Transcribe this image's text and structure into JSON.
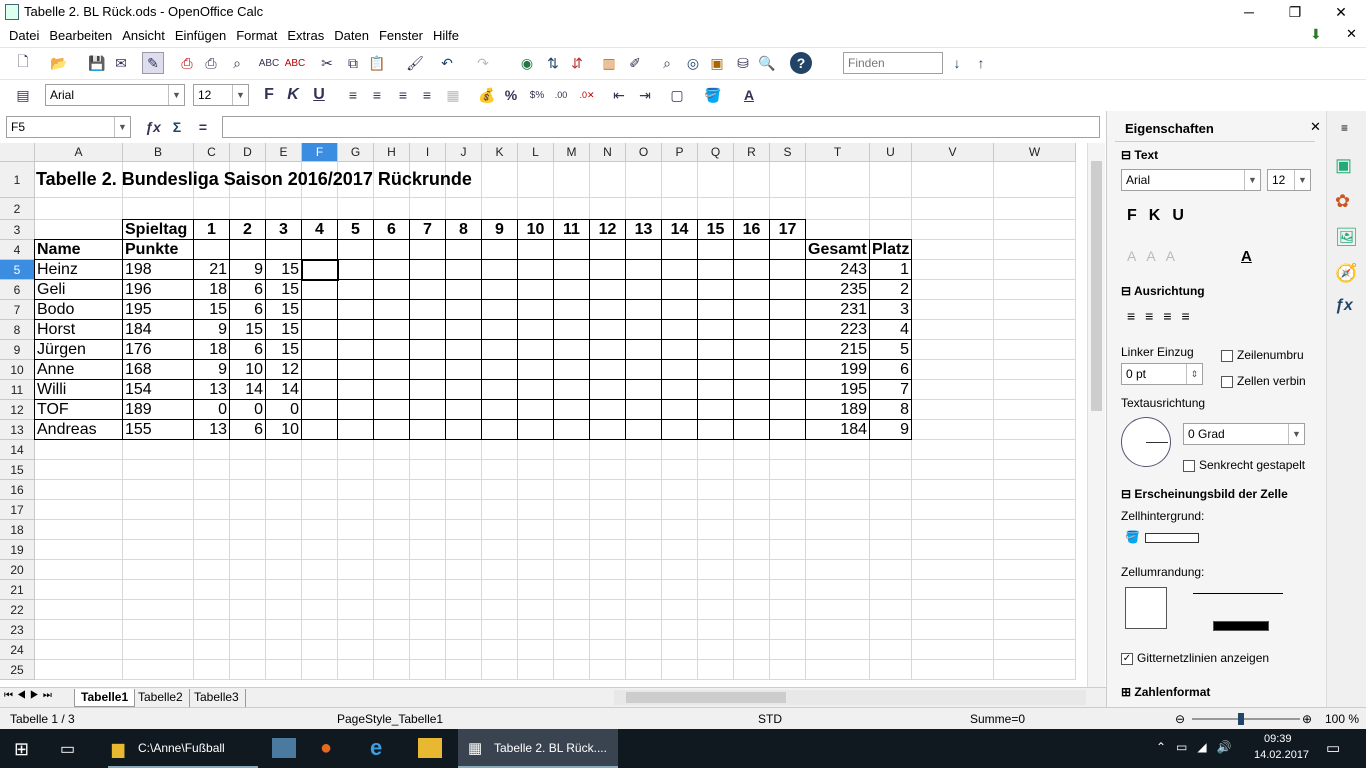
{
  "window": {
    "title": "Tabelle 2. BL Rück.ods - OpenOffice Calc",
    "minimize": "─",
    "restore": "❐",
    "close": "✕"
  },
  "menu": [
    "Datei",
    "Bearbeiten",
    "Ansicht",
    "Einfügen",
    "Format",
    "Extras",
    "Daten",
    "Fenster",
    "Hilfe"
  ],
  "toolbar": {
    "find_placeholder": "Finden",
    "font_name": "Arial",
    "font_size": "12",
    "bold": "F",
    "italic": "K",
    "underline": "U"
  },
  "formula": {
    "name_box": "F5",
    "content": ""
  },
  "columns": [
    "A",
    "B",
    "C",
    "D",
    "E",
    "F",
    "G",
    "H",
    "I",
    "J",
    "K",
    "L",
    "M",
    "N",
    "O",
    "P",
    "Q",
    "R",
    "S",
    "T",
    "U",
    "V",
    "W"
  ],
  "rows": [
    "1",
    "2",
    "3",
    "4",
    "5",
    "6",
    "7",
    "8",
    "9",
    "10",
    "11",
    "12",
    "13",
    "14",
    "15",
    "16",
    "17",
    "18",
    "19",
    "20",
    "21",
    "22",
    "23",
    "24",
    "25"
  ],
  "sheet": {
    "title": "Tabelle 2. Bundesliga Saison 2016/2017 Rückrunde",
    "spieltag_label": "Spieltag",
    "matchdays": [
      "1",
      "2",
      "3",
      "4",
      "5",
      "6",
      "7",
      "8",
      "9",
      "10",
      "11",
      "12",
      "13",
      "14",
      "15",
      "16",
      "17"
    ],
    "name_label": "Name",
    "punkte_label": "Punkte",
    "gesamt_label": "Gesamt",
    "platz_label": "Platz",
    "players": [
      {
        "name": "Heinz",
        "punkte": "198",
        "c": "21",
        "d": "9",
        "e": "15",
        "gesamt": "243",
        "platz": "1"
      },
      {
        "name": "Geli",
        "punkte": "196",
        "c": "18",
        "d": "6",
        "e": "15",
        "gesamt": "235",
        "platz": "2"
      },
      {
        "name": "Bodo",
        "punkte": "195",
        "c": "15",
        "d": "6",
        "e": "15",
        "gesamt": "231",
        "platz": "3"
      },
      {
        "name": "Horst",
        "punkte": "184",
        "c": "9",
        "d": "15",
        "e": "15",
        "gesamt": "223",
        "platz": "4"
      },
      {
        "name": "Jürgen",
        "punkte": "176",
        "c": "18",
        "d": "6",
        "e": "15",
        "gesamt": "215",
        "platz": "5"
      },
      {
        "name": "Anne",
        "punkte": "168",
        "c": "9",
        "d": "10",
        "e": "12",
        "gesamt": "199",
        "platz": "6"
      },
      {
        "name": "Willi",
        "punkte": "154",
        "c": "13",
        "d": "14",
        "e": "14",
        "gesamt": "195",
        "platz": "7"
      },
      {
        "name": "TOF",
        "punkte": "189",
        "c": "0",
        "d": "0",
        "e": "0",
        "gesamt": "189",
        "platz": "8"
      },
      {
        "name": "Andreas",
        "punkte": "155",
        "c": "13",
        "d": "6",
        "e": "10",
        "gesamt": "184",
        "platz": "9"
      }
    ]
  },
  "tabs": [
    "Tabelle1",
    "Tabelle2",
    "Tabelle3"
  ],
  "status": {
    "sheet": "Tabelle 1 / 3",
    "pagestyle": "PageStyle_Tabelle1",
    "mode": "STD",
    "sum": "Summe=0",
    "zoom": "100 %"
  },
  "sidebar": {
    "title": "Eigenschaften",
    "text_section": "Text",
    "font": "Arial",
    "size": "12",
    "align_section": "Ausrichtung",
    "indent_label": "Linker Einzug",
    "indent_value": "0 pt",
    "wrap": "Zeilenumbru",
    "merge": "Zellen verbin",
    "orient_label": "Textausrichtung",
    "orient_value": "0 Grad",
    "stacked": "Senkrecht gestapelt",
    "appearance_section": "Erscheinungsbild der Zelle",
    "bg_label": "Zellhintergrund:",
    "border_label": "Zellumrandung:",
    "gridlines": "Gitternetzlinien anzeigen",
    "number_section": "Zahlenformat"
  },
  "taskbar": {
    "explorer": "C:\\Anne\\Fußball",
    "calc": "Tabelle 2. BL Rück....",
    "time": "09:39",
    "date": "14.02.2017"
  }
}
